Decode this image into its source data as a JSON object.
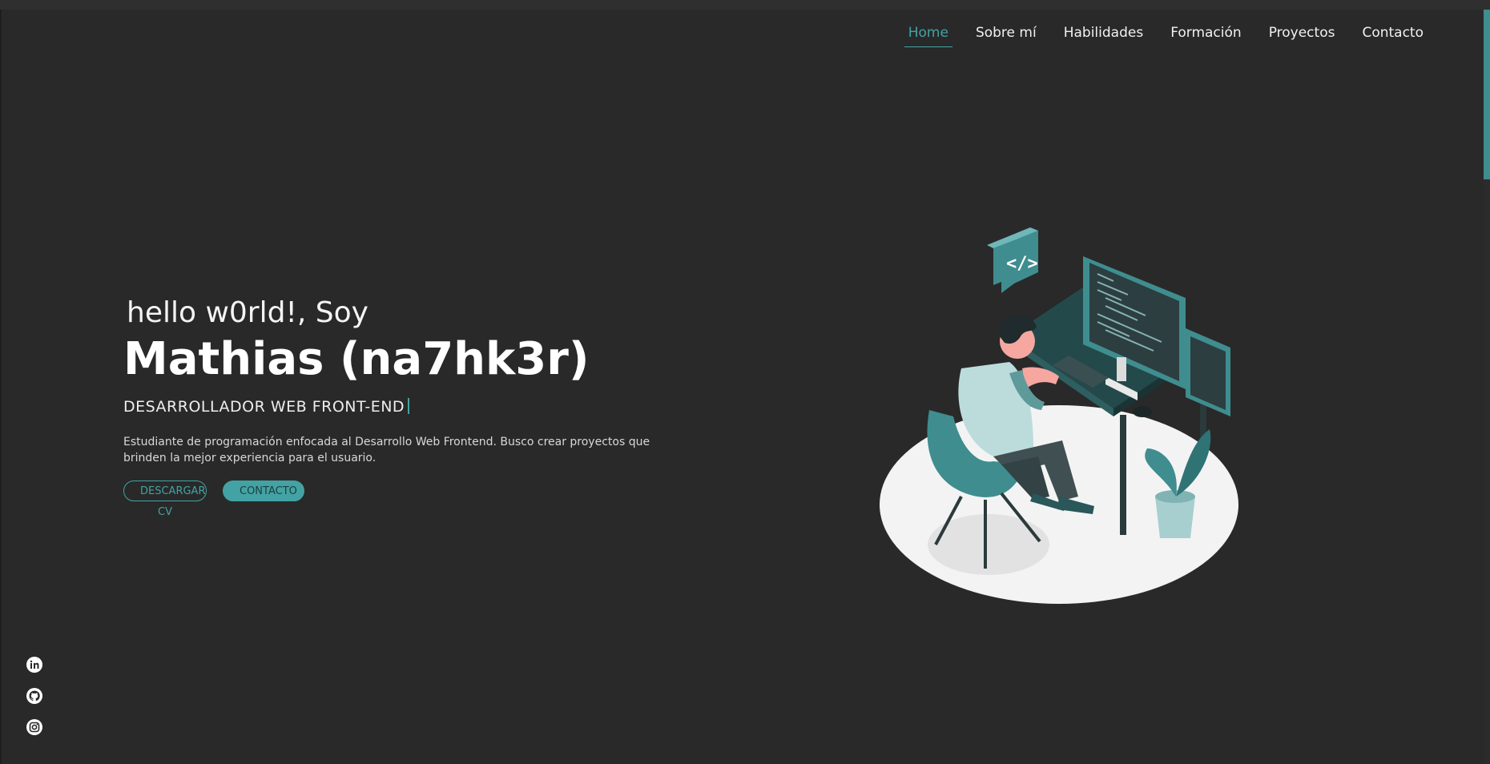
{
  "nav": {
    "items": [
      {
        "label": "Home",
        "active": true
      },
      {
        "label": "Sobre mí"
      },
      {
        "label": "Habilidades"
      },
      {
        "label": "Formación"
      },
      {
        "label": "Proyectos"
      },
      {
        "label": "Contacto"
      }
    ]
  },
  "hero": {
    "greeting": "hello w0rld!, Soy",
    "name": "Mathias (na7hk3r)",
    "role": "DESARROLLADOR WEB FRONT-END",
    "description": "Estudiante de programación enfocada al Desarrollo Web Frontend. Busco crear proyectos que brinden la mejor experiencia para el usuario.",
    "download_cv": "DESCARGAR CV",
    "contact": "CONTACTO"
  },
  "social": {
    "icons": [
      "linkedin-icon",
      "github-icon",
      "instagram-icon"
    ]
  },
  "illustration": {
    "code_bubble": "</>"
  },
  "colors": {
    "background": "#292929",
    "accent": "#43a3a4",
    "text": "#f1f1f1"
  }
}
